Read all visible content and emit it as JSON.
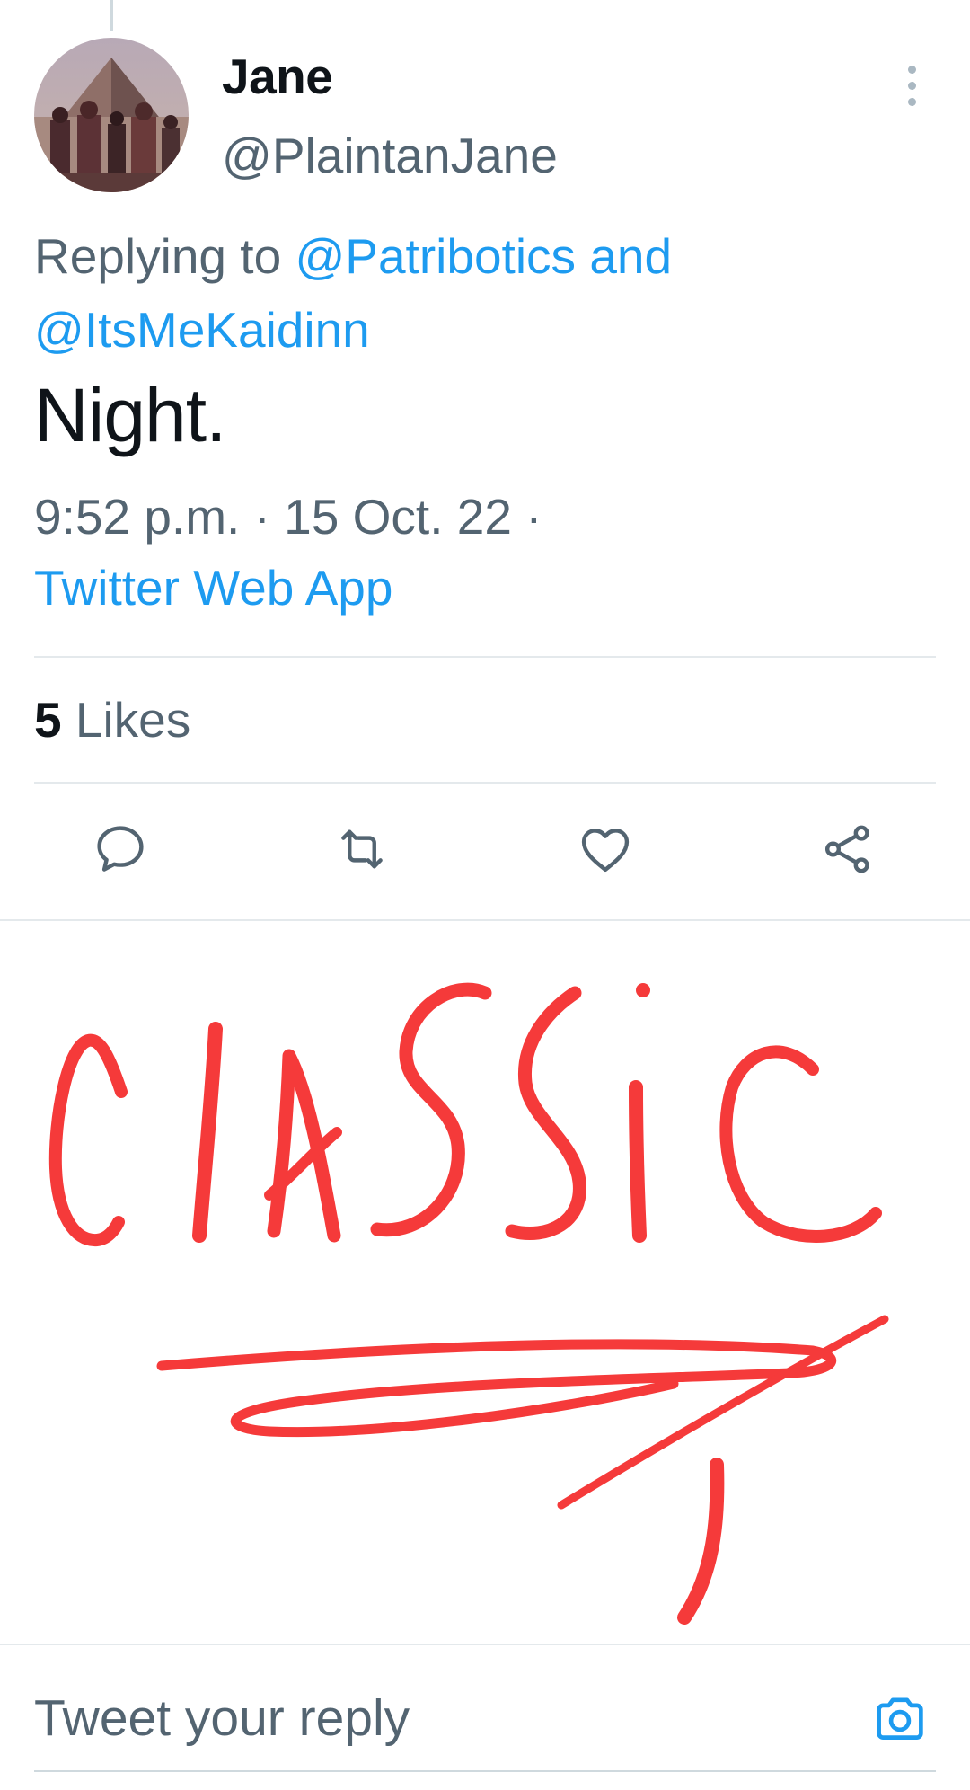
{
  "tweet": {
    "author": {
      "display_name": "Jane",
      "handle": "@PlaintanJane",
      "avatar": "avatar-photo-pyramid"
    },
    "reply_prefix": "Replying to",
    "reply_mentions": [
      "@Patribotics",
      "@ItsMeKaidinn"
    ],
    "reply_joiner": "and",
    "text": "Night.",
    "timestamp": "9:52 p.m. · 15 Oct. 22 ·",
    "source": "Twitter Web App",
    "likes": {
      "count": "5",
      "label": "Likes"
    }
  },
  "actions": {
    "reply_icon": "reply-bubble-icon",
    "retweet_icon": "retweet-icon",
    "like_icon": "heart-icon",
    "share_icon": "share-icon",
    "more_icon": "more-vertical-icon"
  },
  "annotation": {
    "text": "CIASSIC",
    "color": "#f53a3a"
  },
  "composer": {
    "placeholder": "Tweet your reply",
    "camera_icon": "camera-icon"
  },
  "colors": {
    "link": "#1d9bf0",
    "secondary_text": "#536471",
    "primary_text": "#0f1419",
    "divider": "#e4e9ec",
    "annotation_red": "#f53a3a"
  }
}
